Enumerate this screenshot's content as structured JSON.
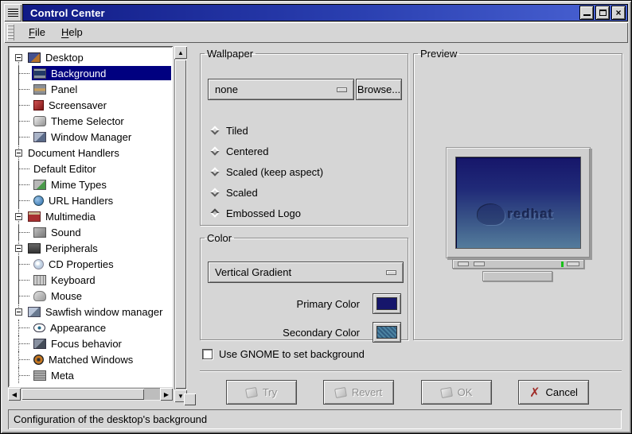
{
  "window": {
    "title": "Control Center"
  },
  "titlebar": {
    "controls": [
      "minimize",
      "maximize",
      "close"
    ]
  },
  "menubar": {
    "items": [
      {
        "label": "File",
        "mnemonic": "F"
      },
      {
        "label": "Help",
        "mnemonic": "H"
      }
    ]
  },
  "tree": {
    "items": [
      {
        "label": "Desktop",
        "depth": 0,
        "expander": "minus",
        "icon": "desktop",
        "selected": false
      },
      {
        "label": "Background",
        "depth": 1,
        "expander": null,
        "icon": "background",
        "selected": true
      },
      {
        "label": "Panel",
        "depth": 1,
        "expander": null,
        "icon": "panel",
        "selected": false
      },
      {
        "label": "Screensaver",
        "depth": 1,
        "expander": null,
        "icon": "screensaver",
        "selected": false
      },
      {
        "label": "Theme Selector",
        "depth": 1,
        "expander": null,
        "icon": "theme-selector",
        "selected": false
      },
      {
        "label": "Window Manager",
        "depth": 1,
        "expander": null,
        "icon": "window-manager",
        "selected": false
      },
      {
        "label": "Document Handlers",
        "depth": 0,
        "expander": "minus",
        "icon": null,
        "selected": false
      },
      {
        "label": "Default Editor",
        "depth": 1,
        "expander": null,
        "icon": null,
        "selected": false
      },
      {
        "label": "Mime Types",
        "depth": 1,
        "expander": null,
        "icon": "mime-types",
        "selected": false
      },
      {
        "label": "URL Handlers",
        "depth": 1,
        "expander": null,
        "icon": "url-handlers",
        "selected": false
      },
      {
        "label": "Multimedia",
        "depth": 0,
        "expander": "minus",
        "icon": "multimedia",
        "selected": false
      },
      {
        "label": "Sound",
        "depth": 1,
        "expander": null,
        "icon": "sound",
        "selected": false
      },
      {
        "label": "Peripherals",
        "depth": 0,
        "expander": "minus",
        "icon": "peripherals",
        "selected": false
      },
      {
        "label": "CD Properties",
        "depth": 1,
        "expander": null,
        "icon": "cd-properties",
        "selected": false
      },
      {
        "label": "Keyboard",
        "depth": 1,
        "expander": null,
        "icon": "keyboard",
        "selected": false
      },
      {
        "label": "Mouse",
        "depth": 1,
        "expander": null,
        "icon": "mouse",
        "selected": false
      },
      {
        "label": "Sawfish window manager",
        "depth": 0,
        "expander": "minus",
        "icon": "sawfish",
        "selected": false
      },
      {
        "label": "Appearance",
        "depth": 1,
        "expander": null,
        "icon": "appearance",
        "selected": false
      },
      {
        "label": "Focus behavior",
        "depth": 1,
        "expander": null,
        "icon": "focus-behavior",
        "selected": false
      },
      {
        "label": "Matched Windows",
        "depth": 1,
        "expander": null,
        "icon": "matched-windows",
        "selected": false
      },
      {
        "label": "Meta",
        "depth": 1,
        "expander": null,
        "icon": "meta",
        "selected": false
      }
    ]
  },
  "wallpaper": {
    "legend": "Wallpaper",
    "dropdown_value": "none",
    "browse_label": "Browse...",
    "radios": [
      {
        "label": "Tiled",
        "selected": false
      },
      {
        "label": "Centered",
        "selected": false
      },
      {
        "label": "Scaled (keep aspect)",
        "selected": false
      },
      {
        "label": "Scaled",
        "selected": false
      },
      {
        "label": "Embossed Logo",
        "selected": true
      }
    ]
  },
  "color": {
    "legend": "Color",
    "dropdown_value": "Vertical Gradient",
    "primary_label": "Primary Color",
    "secondary_label": "Secondary Color",
    "primary_hex": "#16166b",
    "secondary_hex": "#3d7a99"
  },
  "preview": {
    "legend": "Preview",
    "logo_text": "redhat",
    "led_color": "#19c019"
  },
  "gnome_checkbox": {
    "label": "Use GNOME to set background",
    "checked": false
  },
  "action_buttons": [
    {
      "label": "Try",
      "enabled": false,
      "icon": "try-icon"
    },
    {
      "label": "Revert",
      "enabled": false,
      "icon": "revert-icon"
    },
    {
      "label": "OK",
      "enabled": false,
      "icon": "ok-icon"
    },
    {
      "label": "Cancel",
      "enabled": true,
      "icon": "cancel-icon"
    }
  ],
  "statusbar": {
    "text": "Configuration of the desktop's background"
  }
}
